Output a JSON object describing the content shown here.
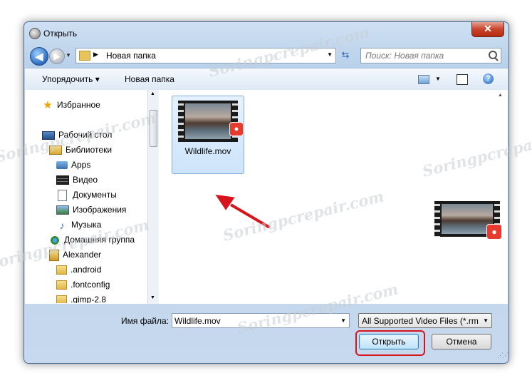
{
  "window": {
    "title": "Открыть",
    "close_label": "✕"
  },
  "nav": {
    "back_label": "◀",
    "forward_label": "▶",
    "address": {
      "path_label": "Новая папка",
      "chevron": "▶"
    },
    "search_placeholder": "Поиск: Новая папка"
  },
  "toolbar": {
    "organize_label": "Упорядочить ▾",
    "new_folder_label": "Новая папка",
    "help_label": "?"
  },
  "sidebar": {
    "items": [
      {
        "label": "Избранное",
        "icon": "star-icon"
      },
      {
        "label": "Рабочий стол",
        "icon": "desktop-icon"
      },
      {
        "label": "Библиотеки",
        "icon": "libraries-icon"
      },
      {
        "label": "Apps",
        "icon": "apps-icon"
      },
      {
        "label": "Видео",
        "icon": "video-icon"
      },
      {
        "label": "Документы",
        "icon": "documents-icon"
      },
      {
        "label": "Изображения",
        "icon": "images-icon"
      },
      {
        "label": "Музыка",
        "icon": "music-icon"
      },
      {
        "label": "Домашняя группа",
        "icon": "homegroup-icon"
      },
      {
        "label": "Alexander",
        "icon": "user-folder-icon"
      },
      {
        "label": ".android",
        "icon": "folder-icon"
      },
      {
        "label": ".fontconfig",
        "icon": "folder-icon"
      },
      {
        "label": ".gimp-2.8",
        "icon": "folder-icon"
      }
    ]
  },
  "files": [
    {
      "name": "Wildlife.mov",
      "selected": true
    }
  ],
  "bottom": {
    "filename_label": "Имя файла:",
    "filename_value": "Wildlife.mov",
    "filetype_value": "All Supported Video Files (*.rm;*.rmvb;*.avi)",
    "open_label": "Открыть",
    "cancel_label": "Отмена"
  },
  "colors": {
    "highlight": "#d7141c",
    "selection": "#cde4fb"
  }
}
